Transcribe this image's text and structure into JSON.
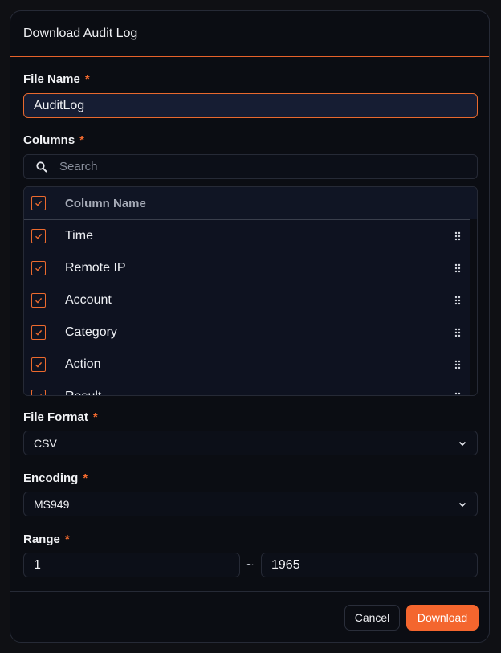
{
  "dialog": {
    "title": "Download Audit Log"
  },
  "file_name": {
    "label": "File Name",
    "required_mark": "*",
    "value": "AuditLog"
  },
  "columns": {
    "label": "Columns",
    "required_mark": "*",
    "search_placeholder": "Search",
    "header": "Column Name",
    "items": [
      {
        "label": "Time",
        "checked": true
      },
      {
        "label": "Remote IP",
        "checked": true
      },
      {
        "label": "Account",
        "checked": true
      },
      {
        "label": "Category",
        "checked": true
      },
      {
        "label": "Action",
        "checked": true
      },
      {
        "label": "Result",
        "checked": true
      }
    ]
  },
  "file_format": {
    "label": "File Format",
    "required_mark": "*",
    "value": "CSV"
  },
  "encoding": {
    "label": "Encoding",
    "required_mark": "*",
    "value": "MS949"
  },
  "range": {
    "label": "Range",
    "required_mark": "*",
    "from": "1",
    "separator": "~",
    "to": "1965"
  },
  "actions": {
    "cancel": "Cancel",
    "download": "Download"
  },
  "colors": {
    "accent": "#f4662e",
    "background": "#0b0d13",
    "border": "#262a36"
  }
}
